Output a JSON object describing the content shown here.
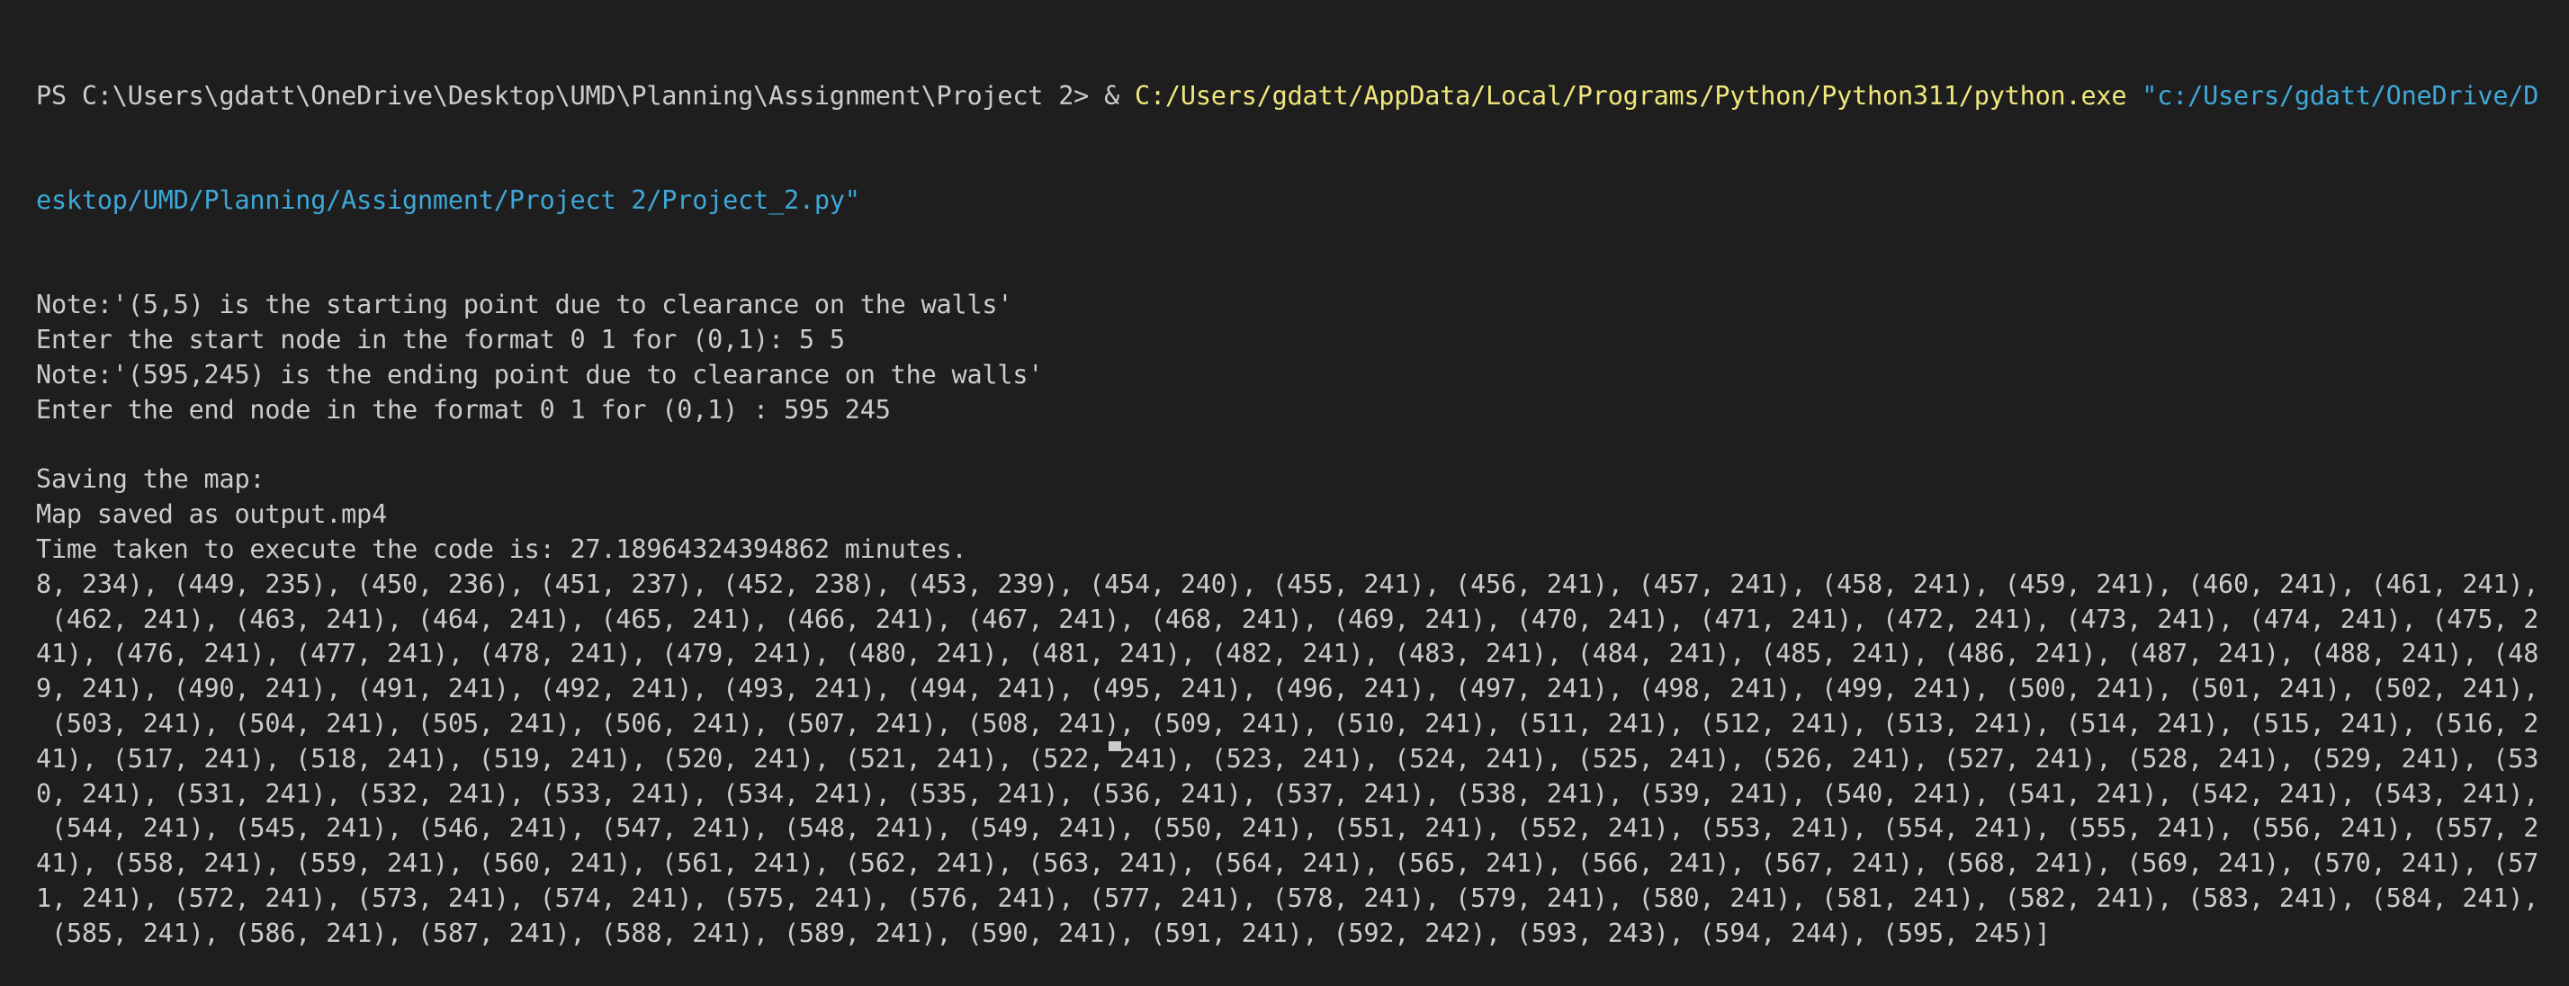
{
  "terminal": {
    "prompt": "PS C:\\Users\\gdatt\\OneDrive\\Desktop\\UMD\\Planning\\Assignment\\Project 2> & ",
    "exe_path": "C:/Users/gdatt/AppData/Local/Programs/Python/Python311/python.exe",
    "script_path_part1": "\"c:/Users/gdatt/OneDrive/D",
    "script_path_part2": "esktop/UMD/Planning/Assignment/Project 2/Project_2.py\"",
    "output_lines": [
      "Note:'(5,5) is the starting point due to clearance on the walls'",
      "Enter the start node in the format 0 1 for (0,1): 5 5",
      "Note:'(595,245) is the ending point due to clearance on the walls'",
      "Enter the end node in the format 0 1 for (0,1) : 595 245",
      "",
      "Saving the map:",
      "Map saved as output.mp4",
      "Time taken to execute the code is: 27.18964324394862 minutes.",
      "8, 234), (449, 235), (450, 236), (451, 237), (452, 238), (453, 239), (454, 240), (455, 241), (456, 241), (457, 241), (458, 241), (459, 241), (460, 241), (461, 241),",
      " (462, 241), (463, 241), (464, 241), (465, 241), (466, 241), (467, 241), (468, 241), (469, 241), (470, 241), (471, 241), (472, 241), (473, 241), (474, 241), (475, 2",
      "41), (476, 241), (477, 241), (478, 241), (479, 241), (480, 241), (481, 241), (482, 241), (483, 241), (484, 241), (485, 241), (486, 241), (487, 241), (488, 241), (48",
      "9, 241), (490, 241), (491, 241), (492, 241), (493, 241), (494, 241), (495, 241), (496, 241), (497, 241), (498, 241), (499, 241), (500, 241), (501, 241), (502, 241),",
      " (503, 241), (504, 241), (505, 241), (506, 241), (507, 241), (508, 241), (509, 241), (510, 241), (511, 241), (512, 241), (513, 241), (514, 241), (515, 241), (516, 2",
      "41), (517, 241), (518, 241), (519, 241), (520, 241), (521, 241), (522, 241), (523, 241), (524, 241), (525, 241), (526, 241), (527, 241), (528, 241), (529, 241), (53",
      "0, 241), (531, 241), (532, 241), (533, 241), (534, 241), (535, 241), (536, 241), (537, 241), (538, 241), (539, 241), (540, 241), (541, 241), (542, 241), (543, 241),",
      " (544, 241), (545, 241), (546, 241), (547, 241), (548, 241), (549, 241), (550, 241), (551, 241), (552, 241), (553, 241), (554, 241), (555, 241), (556, 241), (557, 2",
      "41), (558, 241), (559, 241), (560, 241), (561, 241), (562, 241), (563, 241), (564, 241), (565, 241), (566, 241), (567, 241), (568, 241), (569, 241), (570, 241), (57",
      "1, 241), (572, 241), (573, 241), (574, 241), (575, 241), (576, 241), (577, 241), (578, 241), (579, 241), (580, 241), (581, 241), (582, 241), (583, 241), (584, 241),",
      " (585, 241), (586, 241), (587, 241), (588, 241), (589, 241), (590, 241), (591, 241), (592, 242), (593, 243), (594, 244), (595, 245)]"
    ],
    "colors": {
      "background": "#1e1e1e",
      "text": "#cccccc",
      "exe_path": "#f0e77c",
      "string_arg": "#3ea8d8"
    }
  }
}
